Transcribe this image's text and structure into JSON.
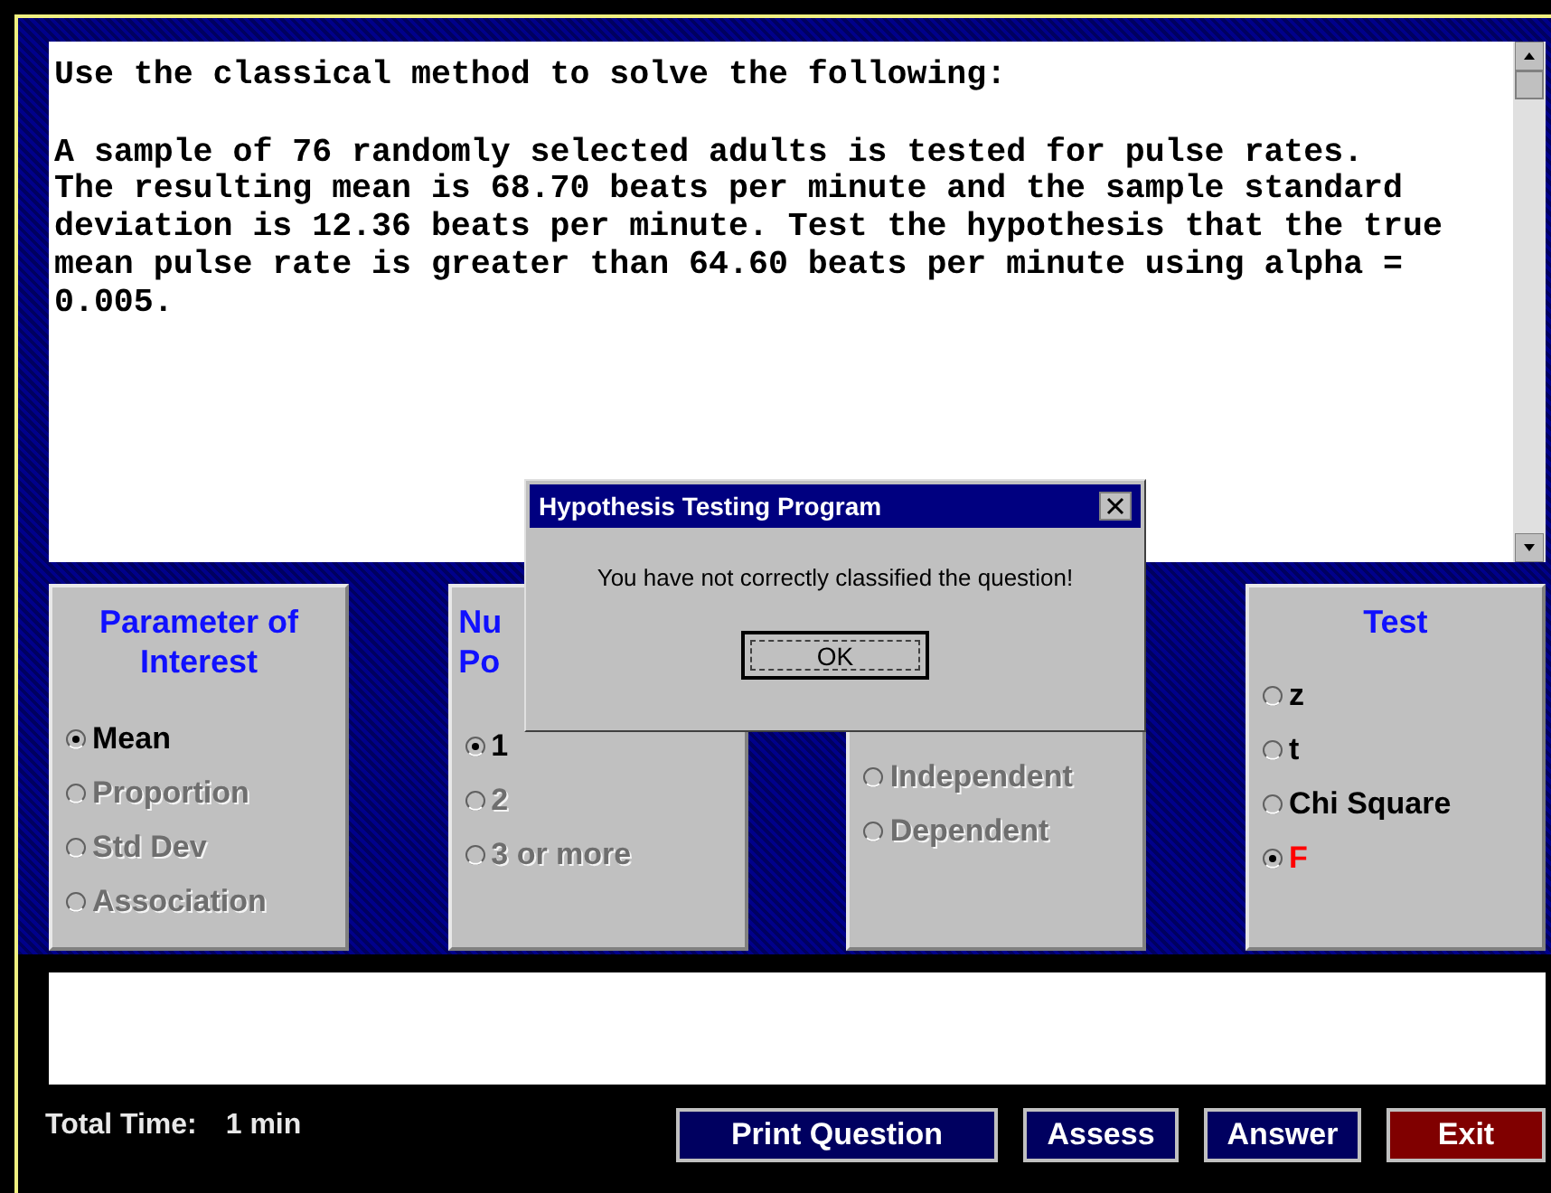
{
  "question": {
    "intro": "Use the classical method to solve the following:",
    "lines": [
      "A sample of 76 randomly selected adults is tested for pulse rates.",
      "The resulting mean is 68.70 beats per minute and the sample standard",
      "deviation is 12.36 beats per minute. Test the hypothesis that the true",
      "mean pulse rate is greater than 64.60 beats per minute using alpha =",
      "0.005."
    ]
  },
  "panels": [
    {
      "title": [
        "Parameter of",
        "Interest"
      ],
      "options": [
        {
          "label": "Mean",
          "selected": true,
          "disabled": false
        },
        {
          "label": "Proportion",
          "selected": false,
          "disabled": true
        },
        {
          "label": "Std Dev",
          "selected": false,
          "disabled": true
        },
        {
          "label": "Association",
          "selected": false,
          "disabled": true
        }
      ]
    },
    {
      "title": [
        "Nu",
        "Po"
      ],
      "options": [
        {
          "label": "1",
          "selected": true,
          "disabled": false
        },
        {
          "label": "2",
          "selected": false,
          "disabled": true
        },
        {
          "label": "3 or more",
          "selected": false,
          "disabled": true
        }
      ]
    },
    {
      "options": [
        {
          "label": "Independent",
          "selected": false,
          "disabled": true
        },
        {
          "label": "Dependent",
          "selected": false,
          "disabled": true
        }
      ]
    },
    {
      "title": [
        "Test"
      ],
      "options": [
        {
          "label": "z",
          "selected": false,
          "disabled": false,
          "color": "#000000"
        },
        {
          "label": "t",
          "selected": false,
          "disabled": false,
          "color": "#000000"
        },
        {
          "label": "Chi Square",
          "selected": false,
          "disabled": false,
          "color": "#000000"
        },
        {
          "label": "F",
          "selected": true,
          "disabled": false,
          "color": "#ff0000"
        }
      ]
    }
  ],
  "total_time": {
    "label": "Total Time:",
    "value": "1 min"
  },
  "buttons": [
    {
      "label": "Print Question",
      "kind": "normal"
    },
    {
      "label": "Assess",
      "kind": "normal"
    },
    {
      "label": "Answer",
      "kind": "normal"
    },
    {
      "label": "Exit",
      "kind": "exit"
    }
  ],
  "dialog": {
    "title": "Hypothesis Testing Program",
    "message": "You have not correctly classified the question!",
    "button": "OK"
  }
}
